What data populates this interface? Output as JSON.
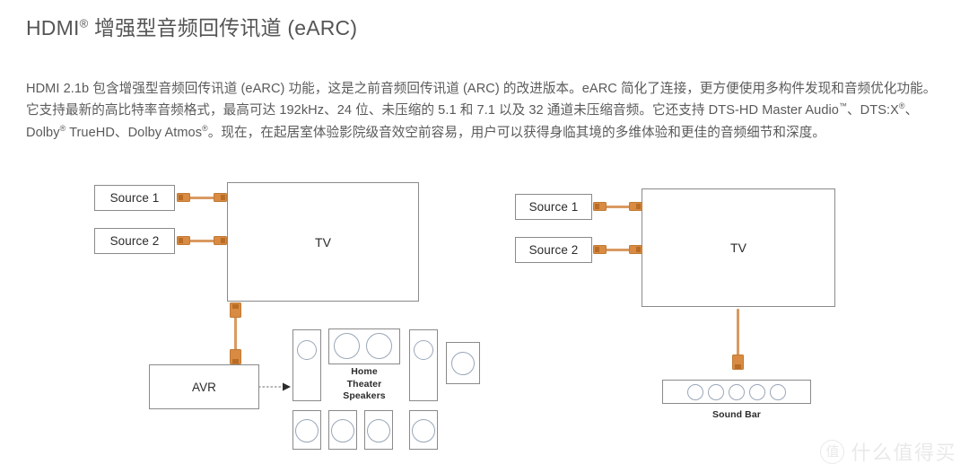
{
  "heading": {
    "prefix": "HDMI",
    "superscript": "®",
    "rest": " 增强型音频回传讯道 (eARC)"
  },
  "body": {
    "p1_a": "HDMI 2.1b 包含增强型音频回传讯道 (eARC) 功能，这是之前音频回传讯道 (ARC) 的改进版本。eARC 简化了连接，更方便使用多构件发现和音频优化功能。它支持最新的高比特率音频格式，最高可达 192kHz、24 位、未压缩的 5.1 和 7.1 以及 32 通道未压缩音频。它还支持 DTS-HD Master Audio",
    "sup_tm": "™",
    "p1_b": "、DTS:X",
    "sup_r1": "®",
    "p1_c": "、Dolby",
    "sup_r2": "®",
    "p1_d": " TrueHD、Dolby Atmos",
    "sup_r3": "®",
    "p1_e": "。现在，在起居室体验影院级音效空前容易，用户可以获得身临其境的多维体验和更佳的音频细节和深度。"
  },
  "diagram_left": {
    "source1": "Source 1",
    "source2": "Source 2",
    "tv": "TV",
    "avr": "AVR",
    "speakers_caption_line1": "Home",
    "speakers_caption_line2": "Theater",
    "speakers_caption_line3": "Speakers"
  },
  "diagram_right": {
    "source1": "Source 1",
    "source2": "Source 2",
    "tv": "TV",
    "soundbar_caption": "Sound Bar",
    "soundbar_driver_count": 5
  },
  "colors": {
    "cable": "#d99a62",
    "plug": "#d98b43",
    "box_border": "#8a8a8a",
    "driver_border": "#9aa7b8",
    "text": "#2b2b2b",
    "body_text": "#5a5a5a"
  },
  "watermark": {
    "logo_glyph": "值",
    "text": "什么值得买"
  }
}
